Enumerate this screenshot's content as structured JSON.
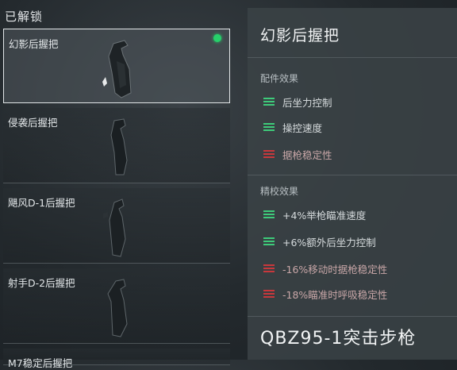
{
  "section_title": "已解锁",
  "items": [
    {
      "label": "幻影后握把",
      "selected": true,
      "equipped": true
    },
    {
      "label": "侵袭后握把"
    },
    {
      "label": "飓风D-1后握把"
    },
    {
      "label": "射手D-2后握把"
    },
    {
      "label": "M7稳定后握把"
    }
  ],
  "detail": {
    "title": "幻影后握把",
    "attachment_effects_title": "配件效果",
    "attachment_effects": [
      {
        "text": "后坐力控制",
        "type": "positive"
      },
      {
        "text": "操控速度",
        "type": "positive"
      },
      {
        "text": "据枪稳定性",
        "type": "negative"
      }
    ],
    "calibration_effects_title": "精校效果",
    "calibration_effects": [
      {
        "text": "+4%举枪瞄准速度",
        "type": "positive"
      },
      {
        "text": "+6%额外后坐力控制",
        "type": "positive"
      },
      {
        "text": "-16%移动时据枪稳定性",
        "type": "negative"
      },
      {
        "text": "-18%瞄准时呼吸稳定性",
        "type": "negative"
      }
    ],
    "weapon_name": "QBZ95-1突击步枪"
  },
  "colors": {
    "positive": "#3ecb7a",
    "negative": "#c8383c",
    "equipped_dot": "#26d06a"
  }
}
